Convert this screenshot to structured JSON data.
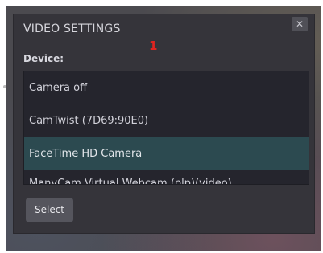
{
  "dialog": {
    "title": "VIDEO SETTINGS",
    "close_icon": "close-icon",
    "marker": "1",
    "device_label": "Device:",
    "devices": [
      {
        "label": "Camera off",
        "selected": false
      },
      {
        "label": "CamTwist (7D69:90E0)",
        "selected": false
      },
      {
        "label": "FaceTime HD Camera",
        "selected": true
      },
      {
        "label": "ManyCam Virtual Webcam (plp)(video)",
        "selected": false
      }
    ],
    "select_label": "Select"
  },
  "colors": {
    "modal_bg": "#35343a",
    "list_bg": "#25252d",
    "selected_bg": "#2c4a50",
    "marker": "#e02420",
    "button_bg": "#55555d"
  }
}
